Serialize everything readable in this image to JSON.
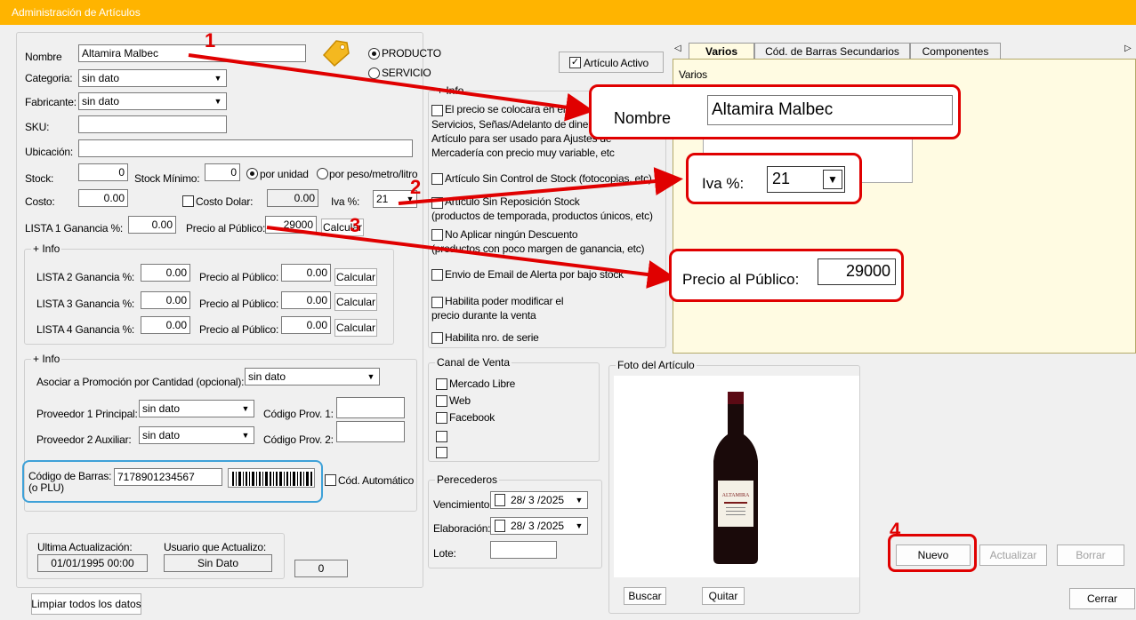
{
  "window": {
    "title": "Administración de Artículos"
  },
  "main": {
    "nombre_label": "Nombre",
    "nombre_value": "Altamira Malbec",
    "categoria_label": "Categoria:",
    "categoria_value": "sin dato",
    "fabricante_label": "Fabricante:",
    "fabricante_value": "sin dato",
    "sku_label": "SKU:",
    "ubicacion_label": "Ubicación:",
    "stock_label": "Stock:",
    "stock_value": "0",
    "stock_minimo_label": "Stock Mínimo:",
    "stock_minimo_value": "0",
    "por_unidad_label": "por unidad",
    "por_peso_label": "por peso/metro/litro",
    "costo_label": "Costo:",
    "costo_value": "0.00",
    "costo_dolar_label": "Costo Dolar:",
    "costo_dolar_value": "0.00",
    "iva_label": "Iva %:",
    "iva_value": "21",
    "lista1_label": "LISTA 1 Ganancia %:",
    "lista1_value": "0.00",
    "precio_publico_label": "Precio al Público:",
    "precio_publico_value": "29000",
    "calcular_label": "Calcular",
    "producto_label": "PRODUCTO",
    "servicio_label": "SERVICIO",
    "articulo_activo_label": "Artículo Activo"
  },
  "info_group": {
    "title": "+ Info",
    "lista2_label": "LISTA 2 Ganancia %:",
    "lista2_value": "0.00",
    "lista3_label": "LISTA 3 Ganancia %:",
    "lista3_value": "0.00",
    "lista4_label": "LISTA 4 Ganancia %:",
    "lista4_value": "0.00",
    "precio_label": "Precio al Público:",
    "precio2_value": "0.00",
    "precio3_value": "0.00",
    "precio4_value": "0.00",
    "calcular_label": "Calcular"
  },
  "info_group2": {
    "title": "+ Info",
    "promo_label": "Asociar a Promoción por Cantidad (opcional):",
    "promo_value": "sin dato",
    "prov1_label": "Proveedor 1 Principal:",
    "prov1_value": "sin dato",
    "codprov1_label": "Código Prov. 1:",
    "prov2_label": "Proveedor 2 Auxiliar:",
    "prov2_value": "sin dato",
    "codprov2_label": "Código Prov. 2:",
    "barcode_label_1": "Código de Barras:",
    "barcode_label_2": "(o PLU)",
    "barcode_value": "7178901234567",
    "cod_auto_label": "Cód. Automático"
  },
  "footer": {
    "ultima_label": "Ultima Actualización:",
    "ultima_value": "01/01/1995 00:00",
    "usuario_label": "Usuario que Actualizo:",
    "usuario_value": "Sin Dato",
    "counter_value": "0",
    "limpiar_label": "Limpiar todos los datos"
  },
  "options": {
    "title": "+ Info",
    "opt1_line1": "El precio se colocara en el m",
    "opt1_line2": "Servicios, Señas/Adelanto de diner",
    "opt1_line3": "Artículo para ser usado para Ajustes de",
    "opt1_line4": "Mercadería con precio muy variable, etc",
    "opt2": "Artículo Sin Control de Stock (fotocopias, etc)",
    "opt3_line1": "Artículo Sin Reposición Stock",
    "opt3_line2": "(productos de temporada, productos únicos, etc)",
    "opt4_line1": "No Aplicar ningún Descuento",
    "opt4_line2": "(productos con poco margen de ganancia, etc)",
    "opt5": "Envio de Email de Alerta por bajo stock",
    "opt6_line1": "Habilita poder modificar el",
    "opt6_line2": "precio durante la venta",
    "opt7": "Habilita nro. de serie"
  },
  "canal": {
    "title": "Canal de Venta",
    "items": [
      "Mercado Libre",
      "Web",
      "Facebook"
    ]
  },
  "perecederos": {
    "title": "Perecederos",
    "venc_label": "Vencimiento:",
    "venc_value": "28/ 3 /2025",
    "elab_label": "Elaboración:",
    "elab_value": "28/ 3 /2025",
    "lote_label": "Lote:"
  },
  "foto": {
    "title": "Foto del Artículo",
    "buscar_label": "Buscar",
    "quitar_label": "Quitar",
    "bottle_brand": "ALTAMIRA"
  },
  "tabs": {
    "items": [
      "Varios",
      "Cód. de Barras Secundarios",
      "Componentes"
    ],
    "varios_caption": "Varios"
  },
  "actions": {
    "nuevo": "Nuevo",
    "actualizar": "Actualizar",
    "borrar": "Borrar",
    "cerrar": "Cerrar"
  },
  "callouts": {
    "nombre_label": "Nombre",
    "nombre_value": "Altamira Malbec",
    "iva_label": "Iva %:",
    "iva_value": "21",
    "precio_label": "Precio al Público:",
    "precio_value": "29000",
    "n1": "1",
    "n2": "2",
    "n3": "3",
    "n4": "4",
    "color": "#e00000"
  }
}
